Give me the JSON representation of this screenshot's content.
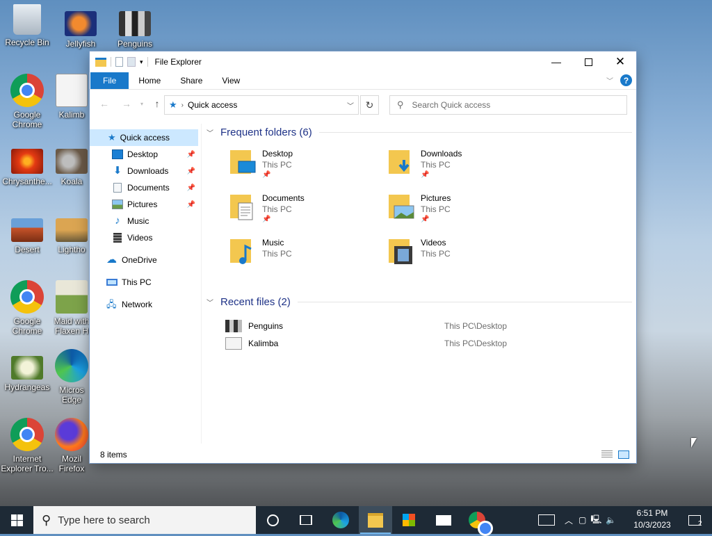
{
  "desktop": {
    "icons": [
      {
        "label": "Recycle Bin"
      },
      {
        "label": "Jellyfish"
      },
      {
        "label": "Penguins"
      },
      {
        "label": "Google Chrome"
      },
      {
        "label": "Kalimb"
      },
      {
        "label": "Chrysanthe..."
      },
      {
        "label": "Koala"
      },
      {
        "label": "Desert"
      },
      {
        "label": "Lightho"
      },
      {
        "label": "Google Chrome"
      },
      {
        "label": "Maid with Flaxen H"
      },
      {
        "label": "Hydrangeas"
      },
      {
        "label": "Micros Edge"
      },
      {
        "label": "Internet Explorer Tro..."
      },
      {
        "label": "Mozil Firefox"
      }
    ]
  },
  "window": {
    "title": "File Explorer",
    "ribbon": {
      "file": "File",
      "home": "Home",
      "share": "Share",
      "view": "View"
    },
    "address": {
      "path": "Quick access"
    },
    "search": {
      "placeholder": "Search Quick access"
    },
    "nav": {
      "quick_access": "Quick access",
      "items": [
        {
          "label": "Desktop",
          "pinned": true
        },
        {
          "label": "Downloads",
          "pinned": true
        },
        {
          "label": "Documents",
          "pinned": true
        },
        {
          "label": "Pictures",
          "pinned": true
        },
        {
          "label": "Music",
          "pinned": false
        },
        {
          "label": "Videos",
          "pinned": false
        }
      ],
      "onedrive": "OneDrive",
      "this_pc": "This PC",
      "network": "Network"
    },
    "frequent": {
      "header": "Frequent folders (6)",
      "folders": [
        {
          "name": "Desktop",
          "location": "This PC",
          "pinned": true
        },
        {
          "name": "Downloads",
          "location": "This PC",
          "pinned": true
        },
        {
          "name": "Documents",
          "location": "This PC",
          "pinned": true
        },
        {
          "name": "Pictures",
          "location": "This PC",
          "pinned": true
        },
        {
          "name": "Music",
          "location": "This PC",
          "pinned": false
        },
        {
          "name": "Videos",
          "location": "This PC",
          "pinned": false
        }
      ]
    },
    "recent": {
      "header": "Recent files (2)",
      "files": [
        {
          "name": "Penguins",
          "path": "This PC\\Desktop"
        },
        {
          "name": "Kalimba",
          "path": "This PC\\Desktop"
        }
      ]
    },
    "status": {
      "count": "8 items"
    }
  },
  "taskbar": {
    "search_placeholder": "Type here to search",
    "time": "6:51 PM",
    "date": "10/3/2023",
    "notifications": "2"
  },
  "colors": {
    "accent": "#1979ca",
    "selection": "#cce8ff",
    "folder": "#f3c74f",
    "taskbar": "#1e2a36"
  }
}
